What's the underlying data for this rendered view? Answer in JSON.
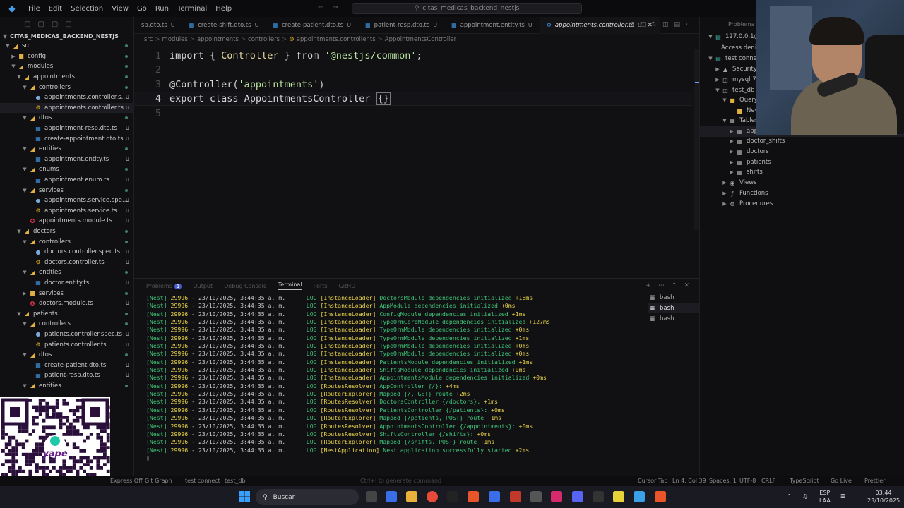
{
  "titlebar": {
    "menu": [
      "File",
      "Edit",
      "Selection",
      "View",
      "Go",
      "Run",
      "Terminal",
      "Help"
    ],
    "search": "citas_medicas_backend_nestjs"
  },
  "explorer": {
    "project": "CITAS_MEDICAS_BACKEND_NESTJS",
    "items": [
      {
        "name": "src",
        "icon": "folder-open-icon",
        "depth": 0,
        "chev": "v",
        "status": ""
      },
      {
        "name": "config",
        "icon": "folder-icon",
        "depth": 1,
        "chev": ">",
        "status": ""
      },
      {
        "name": "modules",
        "icon": "folder-open-icon",
        "depth": 1,
        "chev": "v",
        "status": ""
      },
      {
        "name": "appointments",
        "icon": "folder-open-icon",
        "depth": 2,
        "chev": "v",
        "status": ""
      },
      {
        "name": "controllers",
        "icon": "folder-open-icon",
        "depth": 3,
        "chev": "v",
        "status": ""
      },
      {
        "name": "appointments.controller.spe...",
        "icon": "spec-icon",
        "depth": 4,
        "chev": "",
        "status": "U"
      },
      {
        "name": "appointments.controller.ts",
        "icon": "gear-icon",
        "depth": 4,
        "chev": "",
        "status": "U",
        "selected": true
      },
      {
        "name": "dtos",
        "icon": "folder-open-icon",
        "depth": 3,
        "chev": "v",
        "status": ""
      },
      {
        "name": "appointment-resp.dto.ts",
        "icon": "ts-icon",
        "depth": 4,
        "chev": "",
        "status": "U"
      },
      {
        "name": "create-appointment.dto.ts",
        "icon": "ts-icon",
        "depth": 4,
        "chev": "",
        "status": "U"
      },
      {
        "name": "entities",
        "icon": "folder-open-icon",
        "depth": 3,
        "chev": "v",
        "status": ""
      },
      {
        "name": "appointment.entity.ts",
        "icon": "ts-icon",
        "depth": 4,
        "chev": "",
        "status": "U"
      },
      {
        "name": "enums",
        "icon": "folder-open-icon",
        "depth": 3,
        "chev": "v",
        "status": ""
      },
      {
        "name": "appointment.enum.ts",
        "icon": "ts-icon",
        "depth": 4,
        "chev": "",
        "status": "U"
      },
      {
        "name": "services",
        "icon": "folder-open-icon",
        "depth": 3,
        "chev": "v",
        "status": ""
      },
      {
        "name": "appointments.service.spec.ts",
        "icon": "spec-icon",
        "depth": 4,
        "chev": "",
        "status": "U"
      },
      {
        "name": "appointments.service.ts",
        "icon": "service-icon",
        "depth": 4,
        "chev": "",
        "status": "U"
      },
      {
        "name": "appointments.module.ts",
        "icon": "nest-icon",
        "depth": 3,
        "chev": "",
        "status": "U"
      },
      {
        "name": "doctors",
        "icon": "folder-open-icon",
        "depth": 2,
        "chev": "v",
        "status": ""
      },
      {
        "name": "controllers",
        "icon": "folder-open-icon",
        "depth": 3,
        "chev": "v",
        "status": ""
      },
      {
        "name": "doctors.controller.spec.ts",
        "icon": "spec-icon",
        "depth": 4,
        "chev": "",
        "status": "U"
      },
      {
        "name": "doctors.controller.ts",
        "icon": "gear-icon",
        "depth": 4,
        "chev": "",
        "status": "U"
      },
      {
        "name": "entities",
        "icon": "folder-open-icon",
        "depth": 3,
        "chev": "v",
        "status": ""
      },
      {
        "name": "doctor.entity.ts",
        "icon": "ts-icon",
        "depth": 4,
        "chev": "",
        "status": "U"
      },
      {
        "name": "services",
        "icon": "folder-icon",
        "depth": 3,
        "chev": ">",
        "status": ""
      },
      {
        "name": "doctors.module.ts",
        "icon": "nest-icon",
        "depth": 3,
        "chev": "",
        "status": "U"
      },
      {
        "name": "patients",
        "icon": "folder-open-icon",
        "depth": 2,
        "chev": "v",
        "status": ""
      },
      {
        "name": "controllers",
        "icon": "folder-open-icon",
        "depth": 3,
        "chev": "v",
        "status": ""
      },
      {
        "name": "patients.controller.spec.ts",
        "icon": "spec-icon",
        "depth": 4,
        "chev": "",
        "status": "U"
      },
      {
        "name": "patients.controller.ts",
        "icon": "gear-icon",
        "depth": 4,
        "chev": "",
        "status": "U"
      },
      {
        "name": "dtos",
        "icon": "folder-open-icon",
        "depth": 3,
        "chev": "v",
        "status": ""
      },
      {
        "name": "create-patient.dto.ts",
        "icon": "ts-icon",
        "depth": 4,
        "chev": "",
        "status": "U"
      },
      {
        "name": "patient-resp.dto.ts",
        "icon": "ts-icon",
        "depth": 4,
        "chev": "",
        "status": "U"
      },
      {
        "name": "entities",
        "icon": "folder-open-icon",
        "depth": 3,
        "chev": "v",
        "status": ""
      }
    ]
  },
  "tabs": [
    {
      "label": "sp.dto.ts",
      "mod": "U",
      "active": false
    },
    {
      "label": "create-shift.dto.ts",
      "mod": "U",
      "active": false
    },
    {
      "label": "create-patient.dto.ts",
      "mod": "U",
      "active": false
    },
    {
      "label": "patient-resp.dto.ts",
      "mod": "U",
      "active": false
    },
    {
      "label": "appointment.entity.ts",
      "mod": "U",
      "active": false
    },
    {
      "label": "appointments.controller.ts",
      "mod": "U",
      "active": true
    }
  ],
  "breadcrumb": [
    "src",
    "modules",
    "appointments",
    "controllers",
    "appointments.controller.ts",
    "AppointmentsController"
  ],
  "editor": {
    "line_numbers": [
      "1",
      "2",
      "3",
      "4",
      "5"
    ],
    "line1": {
      "kw1": "import",
      "p1": " { ",
      "cls": "Controller",
      "p2": " } ",
      "kw2": "from",
      "p3": " ",
      "str": "'@nestjs/common'",
      "p4": ";"
    },
    "line3": {
      "dec": "@Controller(",
      "str": "'appointments'",
      "p": ")"
    },
    "line4": {
      "kw1": "export",
      "kw2": " class ",
      "cls": "AppointmentsController",
      "brace": "{}"
    }
  },
  "panel": {
    "tabs": [
      "Problems",
      "Output",
      "Debug Console",
      "Terminal",
      "Ports",
      "GitHD"
    ],
    "problems_count": "1",
    "active_tab": "Terminal",
    "terminals": [
      "bash",
      "bash",
      "bash"
    ]
  },
  "terminal_lines": [
    {
      "ctx": "[InstanceLoader]",
      "msg": "DoctorsModule dependencies initialized",
      "ms": "+18ms"
    },
    {
      "ctx": "[InstanceLoader]",
      "msg": "AppModule dependencies initialized",
      "ms": "+0ms"
    },
    {
      "ctx": "[InstanceLoader]",
      "msg": "ConfigModule dependencies initialized",
      "ms": "+1ms"
    },
    {
      "ctx": "[InstanceLoader]",
      "msg": "TypeOrmCoreModule dependencies initialized",
      "ms": "+127ms"
    },
    {
      "ctx": "[InstanceLoader]",
      "msg": "TypeOrmModule dependencies initialized",
      "ms": "+0ms"
    },
    {
      "ctx": "[InstanceLoader]",
      "msg": "TypeOrmModule dependencies initialized",
      "ms": "+1ms"
    },
    {
      "ctx": "[InstanceLoader]",
      "msg": "TypeOrmModule dependencies initialized",
      "ms": "+0ms"
    },
    {
      "ctx": "[InstanceLoader]",
      "msg": "TypeOrmModule dependencies initialized",
      "ms": "+0ms"
    },
    {
      "ctx": "[InstanceLoader]",
      "msg": "PatientsModule dependencies initialized",
      "ms": "+1ms"
    },
    {
      "ctx": "[InstanceLoader]",
      "msg": "ShiftsModule dependencies initialized",
      "ms": "+0ms"
    },
    {
      "ctx": "[InstanceLoader]",
      "msg": "AppointmentsModule dependencies initialized",
      "ms": "+0ms"
    },
    {
      "ctx": "[RoutesResolver]",
      "msg": "AppController {/}:",
      "ms": "+4ms"
    },
    {
      "ctx": "[RouterExplorer]",
      "msg": "Mapped {/, GET} route",
      "ms": "+2ms"
    },
    {
      "ctx": "[RoutesResolver]",
      "msg": "DoctorsController {/doctors}:",
      "ms": "+1ms"
    },
    {
      "ctx": "[RoutesResolver]",
      "msg": "PatientsController {/patients}:",
      "ms": "+0ms"
    },
    {
      "ctx": "[RouterExplorer]",
      "msg": "Mapped {/patients, POST} route",
      "ms": "+1ms"
    },
    {
      "ctx": "[RoutesResolver]",
      "msg": "AppointmentsController {/appointments}:",
      "ms": "+0ms"
    },
    {
      "ctx": "[RoutesResolver]",
      "msg": "ShiftsController {/shifts}:",
      "ms": "+0ms"
    },
    {
      "ctx": "[RouterExplorer]",
      "msg": "Mapped {/shifts, POST} route",
      "ms": "+1ms"
    },
    {
      "ctx": "[NestApplication]",
      "msg": "Nest application successfully started",
      "ms": "+2ms"
    }
  ],
  "terminal_prefix": {
    "nest": "[Nest]",
    "pid": "29996",
    "date": "- 23/10/2025, 3:44:35 a. m.",
    "log": "LOG"
  },
  "db": {
    "header": "Problema con el m",
    "items": [
      {
        "label": "127.0.0.1@",
        "icon": "server-icon",
        "depth": 0,
        "chev": "v"
      },
      {
        "label": "Access denied",
        "icon": "",
        "depth": 1,
        "chev": ""
      },
      {
        "label": "test connect",
        "icon": "server-icon",
        "depth": 0,
        "chev": "v"
      },
      {
        "label": "Security",
        "icon": "shield-icon",
        "depth": 1,
        "chev": ">"
      },
      {
        "label": "mysql  7.8",
        "icon": "db-icon",
        "depth": 1,
        "chev": ">"
      },
      {
        "label": "test_db  3.",
        "icon": "db-icon",
        "depth": 1,
        "chev": "v"
      },
      {
        "label": "Query",
        "icon": "query-icon",
        "depth": 2,
        "chev": "v"
      },
      {
        "label": "New_Q",
        "icon": "query-icon",
        "depth": 3,
        "chev": ""
      },
      {
        "label": "Tables  (5",
        "icon": "table-icon",
        "depth": 2,
        "chev": "v"
      },
      {
        "label": "appoin",
        "icon": "table-icon",
        "depth": 3,
        "chev": ">",
        "selected": true
      },
      {
        "label": "doctor_shifts",
        "icon": "table-icon",
        "depth": 3,
        "chev": ">"
      },
      {
        "label": "doctors",
        "icon": "table-icon",
        "depth": 3,
        "chev": ">"
      },
      {
        "label": "patients",
        "icon": "table-icon",
        "depth": 3,
        "chev": ">"
      },
      {
        "label": "shifts",
        "icon": "table-icon",
        "depth": 3,
        "chev": ">"
      },
      {
        "label": "Views",
        "icon": "view-icon",
        "depth": 2,
        "chev": ">"
      },
      {
        "label": "Functions",
        "icon": "function-icon",
        "depth": 2,
        "chev": ">"
      },
      {
        "label": "Procedures",
        "icon": "procedure-icon",
        "depth": 2,
        "chev": ">"
      }
    ]
  },
  "statusbar": {
    "express": "Express Off",
    "git_graph": "Git Graph",
    "connection": "test connect",
    "database": "test_db",
    "hint": "Ctrl+I to generate command",
    "cursor_tab": "Cursor Tab",
    "position": "Ln 4, Col 39",
    "spaces": "Spaces: 1",
    "encoding": "UTF-8",
    "eol": "CRLF",
    "language": "TypeScript",
    "golive": "Go Live",
    "prettier": "Prettier"
  },
  "taskbar": {
    "search": "Buscar",
    "lang": "ESP",
    "layout": "LAA",
    "time": "03:44",
    "date": "23/10/2025"
  },
  "qr": {
    "brand": "yape"
  }
}
